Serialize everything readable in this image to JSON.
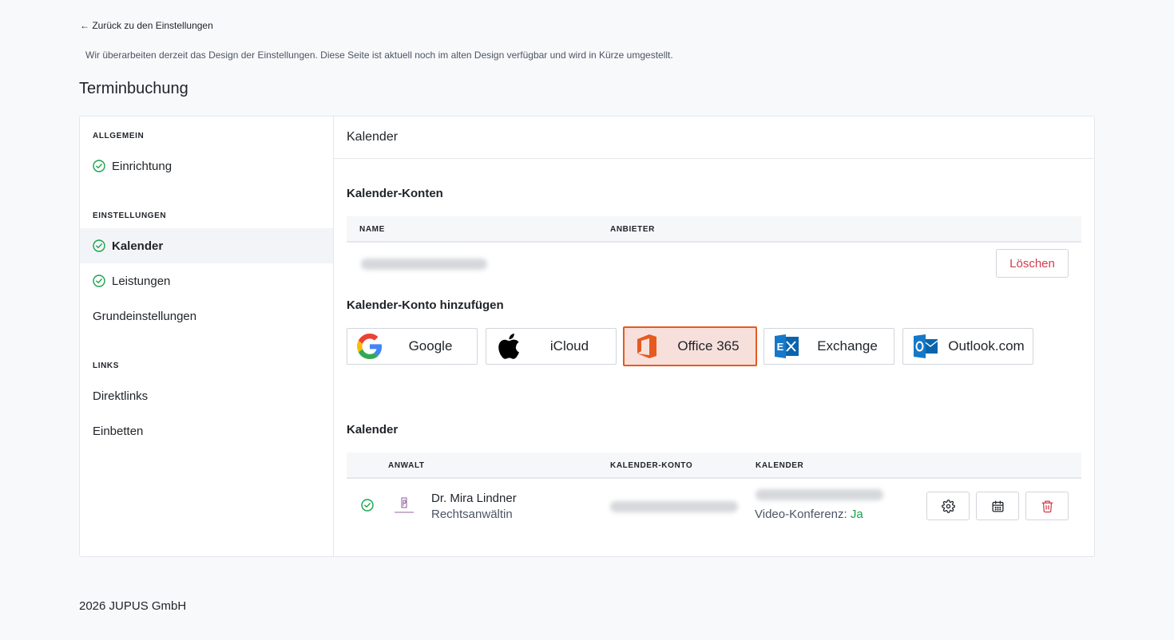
{
  "nav": {
    "back_label": "← Zurück zu den Einstellungen",
    "notice": "Wir überarbeiten derzeit das Design der Einstellungen. Diese Seite ist aktuell noch im alten Design verfügbar und wird in Kürze umgestellt."
  },
  "page": {
    "title": "Terminbuchung"
  },
  "sidebar": {
    "sections": [
      {
        "heading": "ALLGEMEIN",
        "items": [
          {
            "label": "Einrichtung",
            "checked": true
          }
        ]
      },
      {
        "heading": "EINSTELLUNGEN",
        "items": [
          {
            "label": "Kalender",
            "checked": true,
            "active": true
          },
          {
            "label": "Leistungen",
            "checked": true
          },
          {
            "label": "Grundeinstellungen",
            "checked": false
          }
        ]
      },
      {
        "heading": "LINKS",
        "items": [
          {
            "label": "Direktlinks",
            "checked": false
          },
          {
            "label": "Einbetten",
            "checked": false
          }
        ]
      }
    ]
  },
  "main": {
    "header": "Kalender",
    "accounts": {
      "title": "Kalender-Konten",
      "columns": [
        "NAME",
        "ANBIETER"
      ],
      "delete_label": "Löschen"
    },
    "add_account": {
      "title": "Kalender-Konto hinzufügen",
      "providers": [
        {
          "label": "Google",
          "icon": "google-icon"
        },
        {
          "label": "iCloud",
          "icon": "apple-icon"
        },
        {
          "label": "Office 365",
          "icon": "office365-icon",
          "selected": true
        },
        {
          "label": "Exchange",
          "icon": "exchange-icon"
        },
        {
          "label": "Outlook.com",
          "icon": "outlook-icon"
        }
      ]
    },
    "calendars": {
      "title": "Kalender",
      "columns": [
        "ANWALT",
        "KALENDER-KONTO",
        "KALENDER"
      ],
      "rows": [
        {
          "name": "Dr. Mira Lindner",
          "role": "Rechtsanwältin",
          "video_label": "Video-Konferenz:",
          "video_value": "Ja"
        }
      ]
    }
  },
  "footer": {
    "text": "2026 JUPUS GmbH"
  },
  "colors": {
    "accent_green": "#16a34a",
    "danger": "#d23b4b",
    "office_orange": "#e55a1f"
  }
}
